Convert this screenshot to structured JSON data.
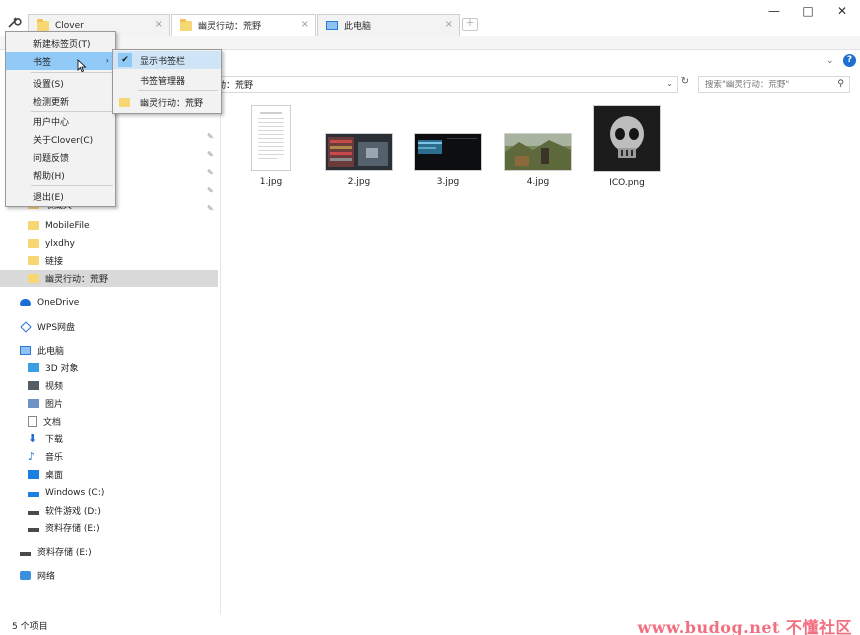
{
  "tabs": [
    {
      "label": "Clover",
      "icon": "folder-icon",
      "close": "×"
    },
    {
      "label": "幽灵行动：荒野",
      "icon": "folder-icon",
      "close": "×"
    },
    {
      "label": "此电脑",
      "icon": "computer-icon",
      "close": "×"
    }
  ],
  "window_controls": {
    "minimize": "—",
    "maximize": "□",
    "close": "✕"
  },
  "address": {
    "path": "动：荒野"
  },
  "search": {
    "placeholder": "搜索\"幽灵行动：荒野\""
  },
  "menu": {
    "items": [
      "新建标签页(T)",
      "书签",
      "设置(S)",
      "检测更新",
      "用户中心",
      "关于Clover(C)",
      "问题反馈",
      "帮助(H)",
      "退出(E)"
    ],
    "submenu": {
      "items": [
        "显示书签栏",
        "书签管理器",
        "幽灵行动：荒野"
      ]
    }
  },
  "nav": {
    "quick_tail": [
      "收藏夹",
      "MobileFile",
      "ylxdhy",
      "链接",
      "幽灵行动：荒野"
    ],
    "onedrive": "OneDrive",
    "wps": "WPS网盘",
    "this_pc": "此电脑",
    "pc_items": [
      "3D 对象",
      "视频",
      "图片",
      "文档",
      "下载",
      "音乐",
      "桌面",
      "Windows (C:)",
      "软件游戏 (D:)",
      "资料存储 (E:)"
    ],
    "drive_e": "资料存储 (E:)",
    "network": "网络"
  },
  "files": [
    {
      "name": "1.jpg"
    },
    {
      "name": "2.jpg"
    },
    {
      "name": "3.jpg"
    },
    {
      "name": "4.jpg"
    },
    {
      "name": "ICO.png"
    }
  ],
  "status": {
    "count": "5 个项目"
  },
  "watermark": "www.budog.net 不懂社区"
}
